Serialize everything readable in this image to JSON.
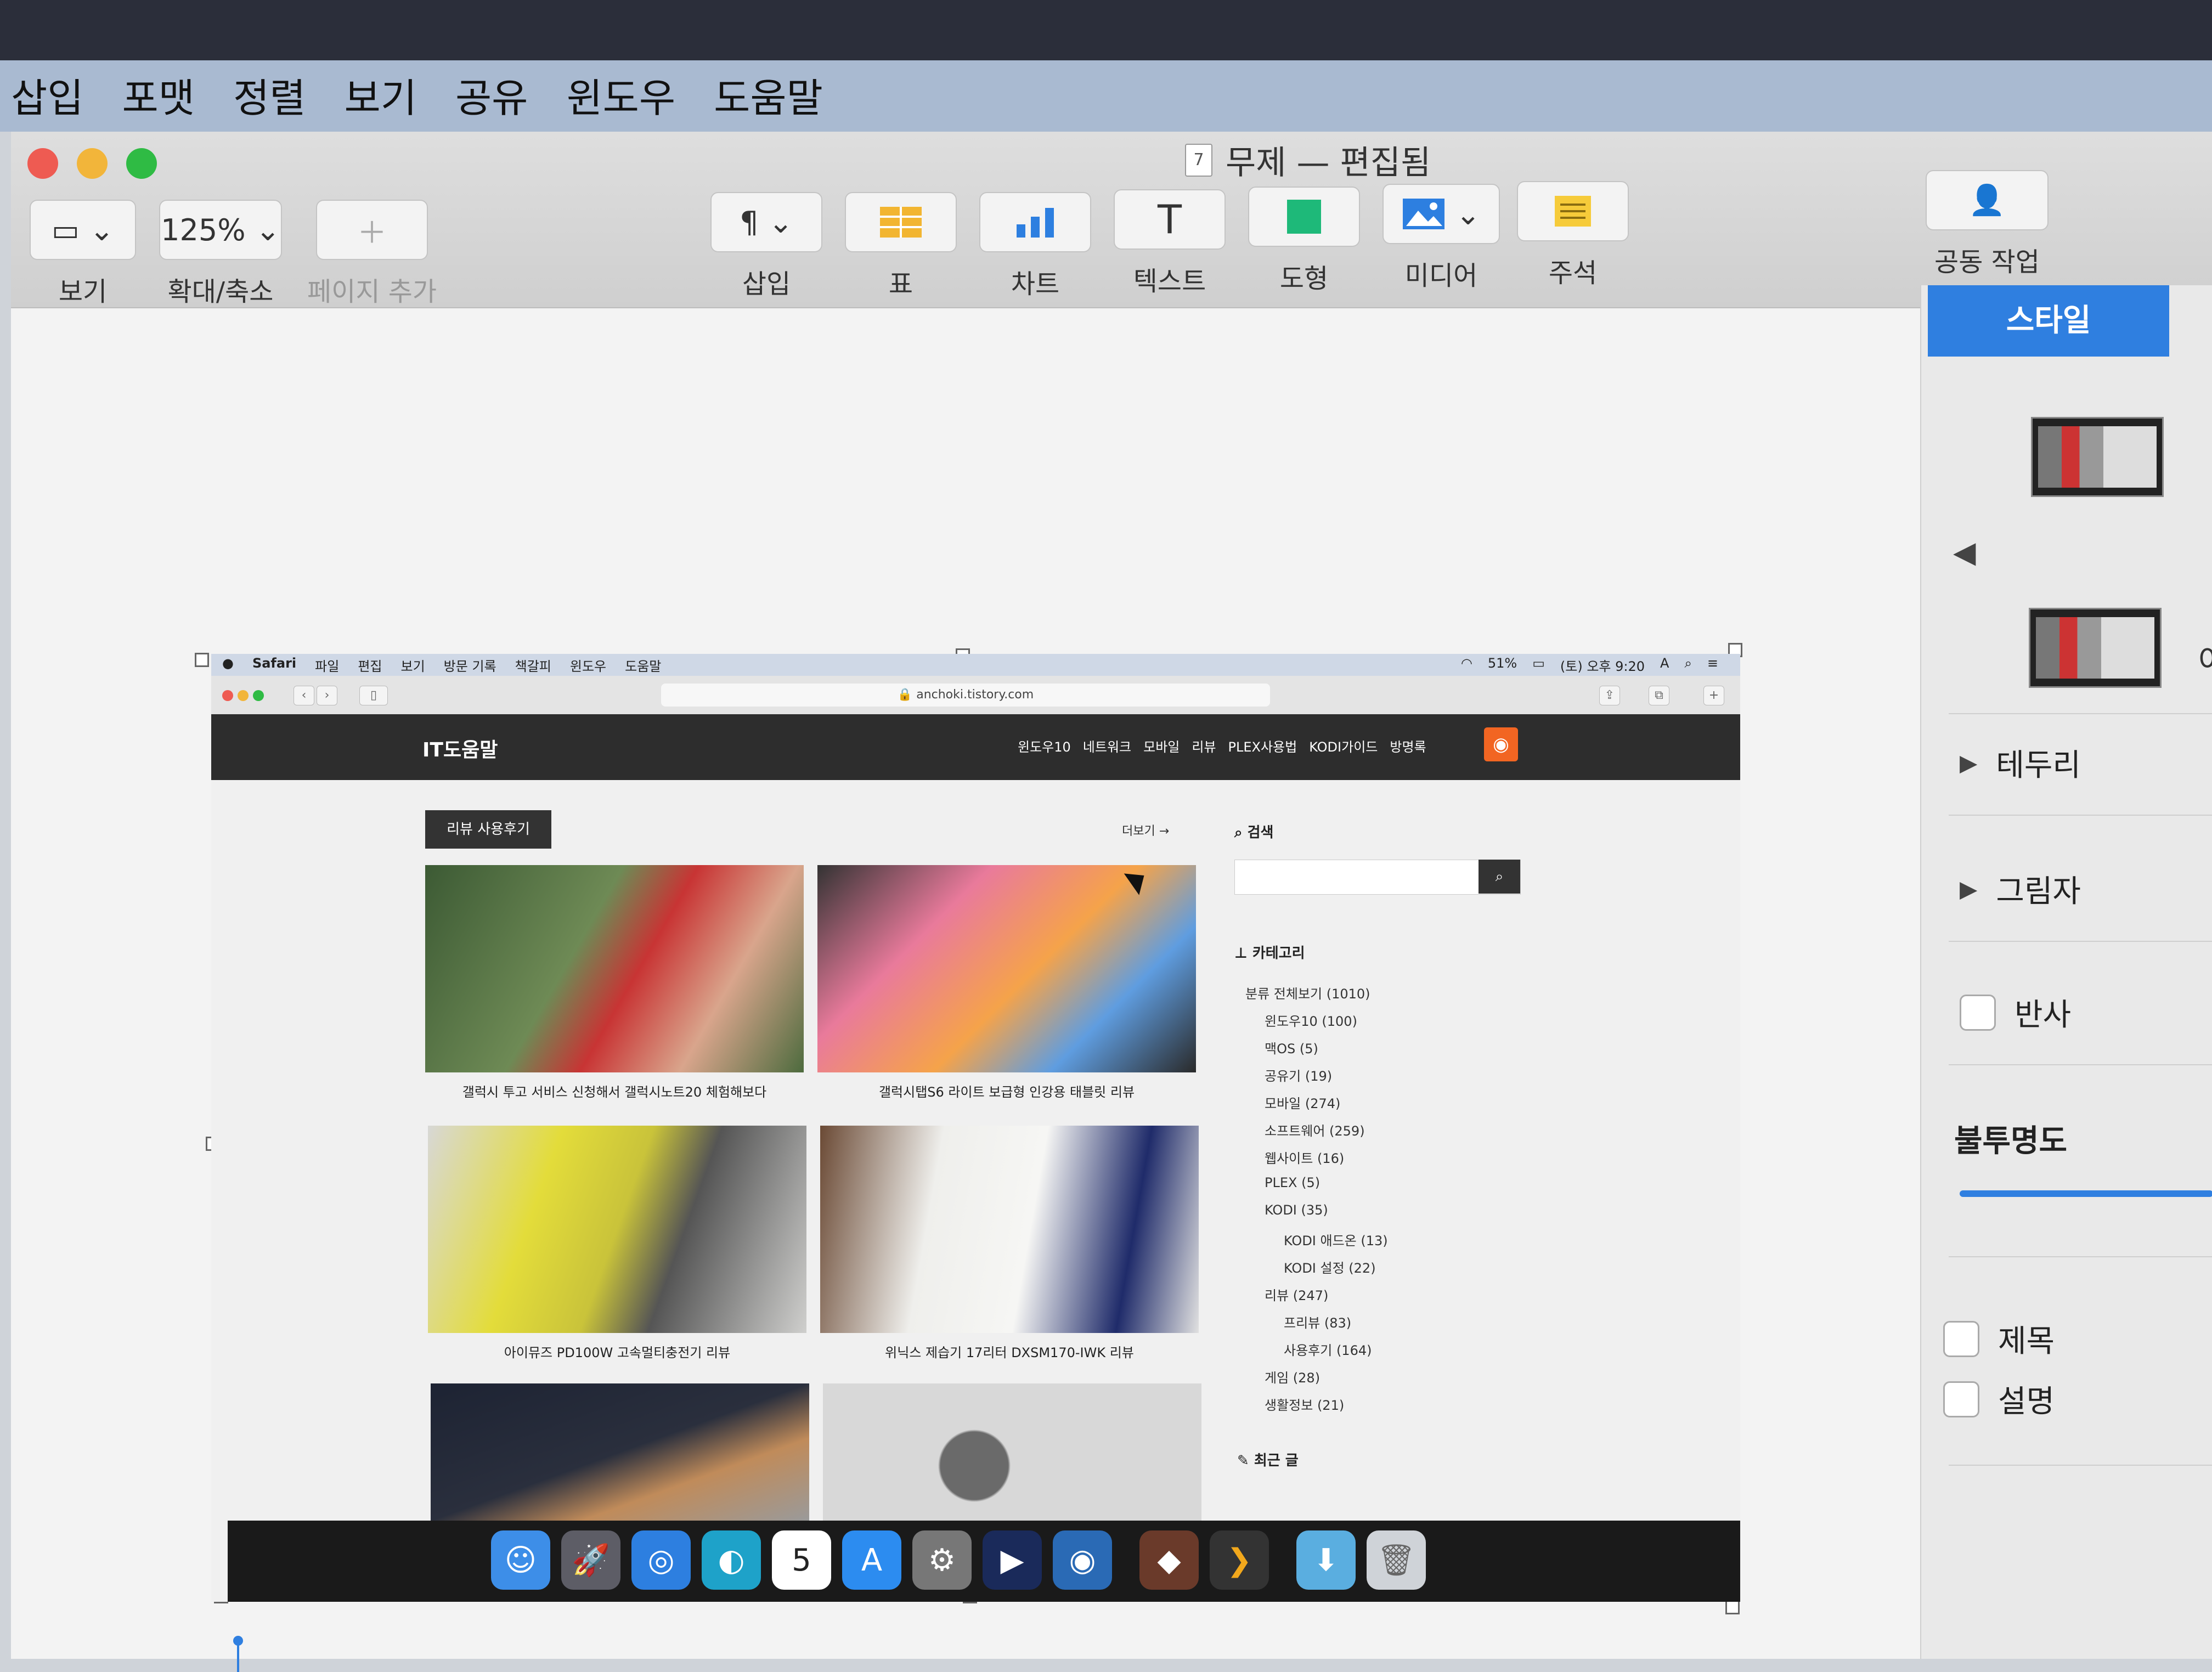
{
  "menubar": {
    "items": [
      "삽입",
      "포맷",
      "정렬",
      "보기",
      "공유",
      "윈도우",
      "도움말"
    ]
  },
  "window": {
    "doc_icon": "7",
    "title": "무제 — 편집됨"
  },
  "toolbar": {
    "view_label": "보기",
    "zoom_value": "125%",
    "zoom_label": "확대/축소",
    "add_page_label": "페이지 추가",
    "insert_label": "삽입",
    "table_label": "표",
    "chart_label": "차트",
    "text_label": "텍스트",
    "shape_label": "도형",
    "media_label": "미디어",
    "comment_label": "주석",
    "collab_label": "공동 작업"
  },
  "sidebar": {
    "style_tab": "스타일",
    "partial_text": "이",
    "border": "테두리",
    "shadow": "그림자",
    "reflection": "반사",
    "opacity": "불투명도",
    "title_check": "제목",
    "caption_check": "설명"
  },
  "embedded": {
    "menubar_items": [
      "Safari",
      "파일",
      "편집",
      "보기",
      "방문 기록",
      "책갈피",
      "윈도우",
      "도움말"
    ],
    "status": [
      "51%",
      "(토) 오후 9:20",
      "A"
    ],
    "url": "anchoki.tistory.com",
    "brand": "IT도움말",
    "nav": [
      "윈도우10",
      "네트워크",
      "모바일",
      "리뷰",
      "PLEX사용법",
      "KODI가이드",
      "방명록"
    ],
    "badge": "리뷰 사용후기",
    "more": "더보기 →",
    "cards": [
      "갤럭시 투고 서비스 신청해서 갤럭시노트20 체험해보다",
      "갤럭시탭S6 라이트 보급형 인강용 태블릿 리뷰",
      "아이뮤즈 PD100W 고속멀티충전기 리뷰",
      "위닉스 제습기 17리터 DXSM170-IWK 리뷰"
    ],
    "search_title": "검색",
    "category_title": "카테고리",
    "categories": [
      "분류 전체보기 (1010)",
      "윈도우10 (100)",
      "맥OS (5)",
      "공유기 (19)",
      "모바일 (274)",
      "소프트웨어 (259)",
      "웹사이트 (16)",
      "PLEX (5)",
      "KODI (35)",
      "KODI 애드온 (13)",
      "KODI 설정 (22)",
      "리뷰 (247)",
      "프리뷰 (83)",
      "사용후기 (164)",
      "게임 (28)",
      "생활정보 (21)"
    ],
    "recent_title": "최근 글"
  }
}
